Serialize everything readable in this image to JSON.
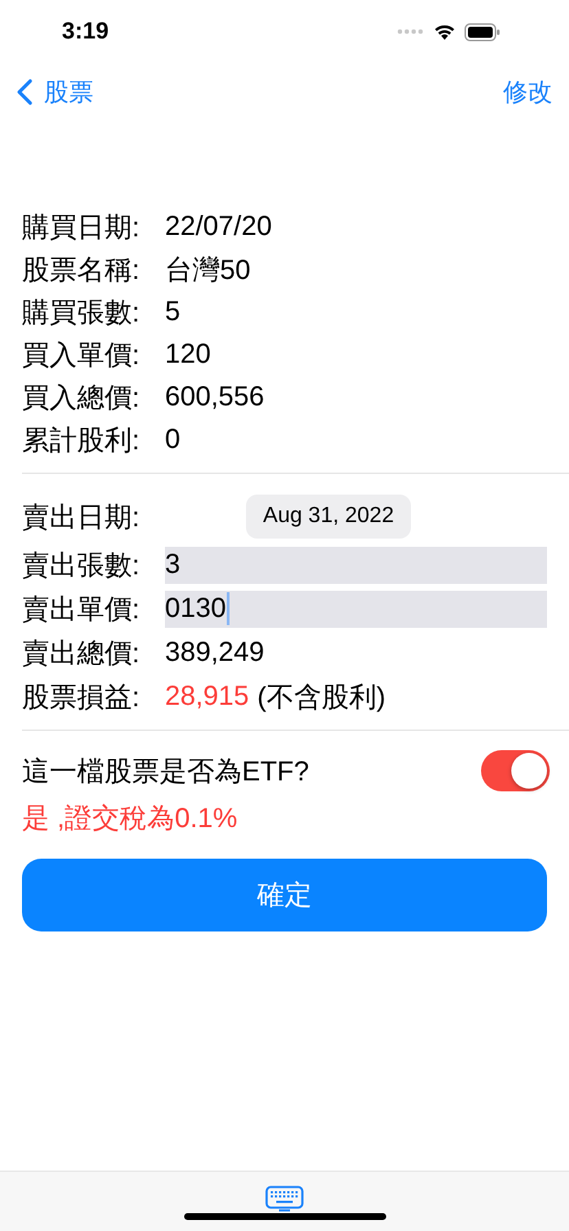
{
  "status_bar": {
    "time": "3:19"
  },
  "nav": {
    "back": "股票",
    "action": "修改"
  },
  "details": [
    {
      "label": "購買日期:",
      "value": "22/07/20"
    },
    {
      "label": "股票名稱:",
      "value": "台灣50"
    },
    {
      "label": "購買張數:",
      "value": "5"
    },
    {
      "label": "買入單價:",
      "value": "120"
    },
    {
      "label": "買入總價:",
      "value": "600,556"
    },
    {
      "label": "累計股利:",
      "value": "0"
    }
  ],
  "sell": [
    {
      "kind": "date",
      "label": "賣出日期:",
      "value": "Aug 31, 2022"
    },
    {
      "kind": "field",
      "label": "賣出張數:",
      "value": "3",
      "focused": false
    },
    {
      "kind": "field",
      "label": "賣出單價:",
      "value": "0130",
      "focused": true
    },
    {
      "kind": "text",
      "label": "賣出總價:",
      "value": "389,249"
    },
    {
      "kind": "profit",
      "label": "股票損益:",
      "value": "28,915",
      "note": "(不含股利)"
    }
  ],
  "etf": {
    "question": "這一檔股票是否為ETF?",
    "on": true,
    "result": "是 ,證交稅為0.1%"
  },
  "confirm": "確定"
}
